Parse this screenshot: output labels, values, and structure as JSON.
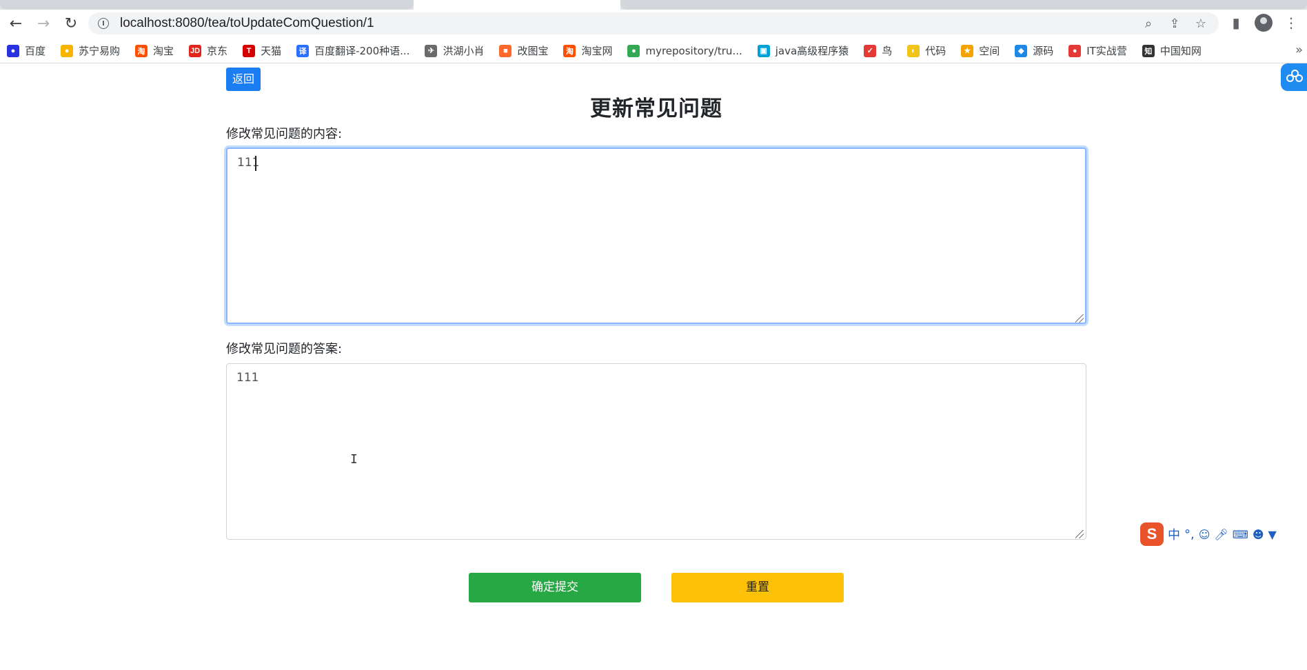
{
  "browser": {
    "url": "localhost:8080/tea/toUpdateComQuestion/1",
    "bookmarks": [
      {
        "label": "百度",
        "icon": "baidu-paw-icon",
        "color": "#2932e1",
        "glyph": "●"
      },
      {
        "label": "苏宁易购",
        "icon": "suning-icon",
        "color": "#f7b500",
        "glyph": "●"
      },
      {
        "label": "淘宝",
        "icon": "taobao-icon",
        "color": "#ff5000",
        "glyph": "淘"
      },
      {
        "label": "京东",
        "icon": "jd-icon",
        "color": "#e1251b",
        "glyph": "JD"
      },
      {
        "label": "天猫",
        "icon": "tmall-icon",
        "color": "#d40000",
        "glyph": "T"
      },
      {
        "label": "百度翻译-200种语...",
        "icon": "baidu-translate-icon",
        "color": "#2b6fff",
        "glyph": "译"
      },
      {
        "label": "洪湖小肖",
        "icon": "bird-icon",
        "color": "#6b6b6b",
        "glyph": "✈"
      },
      {
        "label": "改图宝",
        "icon": "gaitubao-icon",
        "color": "#ff6a2c",
        "glyph": "■"
      },
      {
        "label": "淘宝网",
        "icon": "taobao-icon",
        "color": "#ff5000",
        "glyph": "淘"
      },
      {
        "label": "myrepository/tru...",
        "icon": "chrome-icon",
        "color": "#34a853",
        "glyph": "●"
      },
      {
        "label": "java高级程序猿",
        "icon": "bilibili-icon",
        "color": "#00a1d6",
        "glyph": "▣"
      },
      {
        "label": "鸟",
        "icon": "bird-icon",
        "color": "#e53935",
        "glyph": "✓"
      },
      {
        "label": "代码",
        "icon": "code-icon",
        "color": "#f0c419",
        "glyph": "◐"
      },
      {
        "label": "空间",
        "icon": "qzone-icon",
        "color": "#f4a300",
        "glyph": "★"
      },
      {
        "label": "源码",
        "icon": "fish-icon",
        "color": "#1e88e5",
        "glyph": "◆"
      },
      {
        "label": "IT实战营",
        "icon": "chrome-icon",
        "color": "#e53935",
        "glyph": "●"
      },
      {
        "label": "中国知网",
        "icon": "cnki-icon",
        "color": "#333333",
        "glyph": "知"
      }
    ]
  },
  "page": {
    "back_label": "返回",
    "title": "更新常见问题",
    "content_label": "修改常见问题的内容:",
    "content_value": "111",
    "answer_label": "修改常见问题的答案:",
    "answer_value": "111",
    "submit_label": "确定提交",
    "reset_label": "重置"
  },
  "ime": {
    "logo": "S",
    "mode": "中",
    "punct": "°,"
  },
  "colors": {
    "back_button": "#1a7ef2",
    "submit_button": "#28a745",
    "reset_button": "#ffc107",
    "focus_ring": "#86b7fe"
  }
}
